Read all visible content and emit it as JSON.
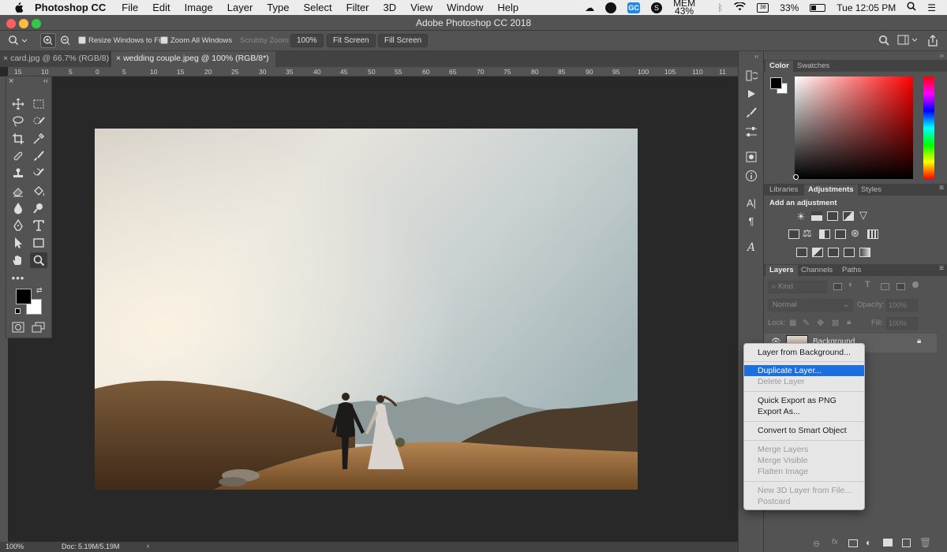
{
  "menubar": {
    "app": "Photoshop CC",
    "items": [
      "File",
      "Edit",
      "Image",
      "Layer",
      "Type",
      "Select",
      "Filter",
      "3D",
      "View",
      "Window",
      "Help"
    ],
    "mem_label": "MEM",
    "mem_value": "43%",
    "battery": "33%",
    "clock": "Tue 12:05 PM"
  },
  "window": {
    "title": "Adobe Photoshop CC 2018"
  },
  "options_bar": {
    "resize_windows": "Resize Windows to Fit",
    "zoom_all": "Zoom All Windows",
    "scrubby_zoom": "Scrubby Zoom",
    "zoom_value": "100%",
    "fit_screen": "Fit Screen",
    "fill_screen": "Fill Screen"
  },
  "doc_tabs": [
    {
      "label": "card.jpg @ 66.7% (RGB/8)",
      "active": false
    },
    {
      "label": "wedding couple.jpeg @ 100% (RGB/8*)",
      "active": true
    }
  ],
  "ruler_ticks": [
    "15",
    "10",
    "5",
    "0",
    "5",
    "10",
    "15",
    "20",
    "25",
    "30",
    "35",
    "40",
    "45",
    "50",
    "55",
    "60",
    "65",
    "70",
    "75",
    "80",
    "85",
    "90",
    "95",
    "100",
    "105",
    "110",
    "11"
  ],
  "status": {
    "zoom": "100%",
    "doc": "Doc: 5.19M/5.19M"
  },
  "color_panel": {
    "tabs": [
      "Color",
      "Swatches"
    ],
    "hue": "#ff0000"
  },
  "adjustments_panel": {
    "tabs": [
      "Libraries",
      "Adjustments",
      "Styles"
    ],
    "heading": "Add an adjustment"
  },
  "layers_panel": {
    "tabs": [
      "Layers",
      "Channels",
      "Paths"
    ],
    "kind_placeholder": "Kind",
    "blend_mode": "Normal",
    "opacity_label": "Opacity:",
    "opacity_value": "100%",
    "lock_label": "Lock:",
    "fill_label": "Fill:",
    "fill_value": "100%",
    "layer_name": "Background"
  },
  "context_menu": {
    "items": [
      {
        "label": "Layer from Background...",
        "enabled": true
      },
      {
        "label": "Duplicate Layer...",
        "enabled": true,
        "highlighted": true
      },
      {
        "label": "Delete Layer",
        "enabled": false
      },
      {
        "label": "Quick Export as PNG",
        "enabled": true
      },
      {
        "label": "Export As...",
        "enabled": true
      },
      {
        "label": "Convert to Smart Object",
        "enabled": true
      },
      {
        "label": "Merge Layers",
        "enabled": false
      },
      {
        "label": "Merge Visible",
        "enabled": false
      },
      {
        "label": "Flatten Image",
        "enabled": false
      },
      {
        "label": "New 3D Layer from File...",
        "enabled": false
      },
      {
        "label": "Postcard",
        "enabled": false
      }
    ]
  }
}
